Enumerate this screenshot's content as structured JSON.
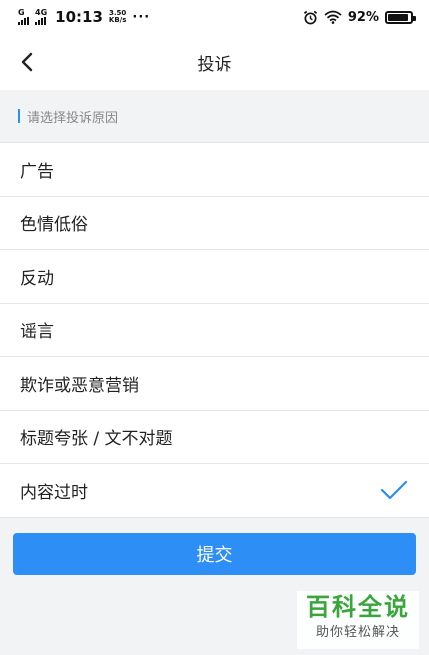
{
  "status_bar": {
    "network_top": "G",
    "network_type": "4G",
    "time": "10:13",
    "speed_value": "3.50",
    "speed_unit": "KB/s",
    "more": "···",
    "alarm_icon": "alarm-clock-icon",
    "wifi_icon": "wifi-icon",
    "battery_percent": "92%",
    "battery_level": 0.92
  },
  "header": {
    "back_icon": "chevron-left-icon",
    "title": "投诉"
  },
  "section": {
    "label": "请选择投诉原因",
    "accent_color": "#2b8ef1"
  },
  "reasons": [
    {
      "label": "广告",
      "selected": false
    },
    {
      "label": "色情低俗",
      "selected": false
    },
    {
      "label": "反动",
      "selected": false
    },
    {
      "label": "谣言",
      "selected": false
    },
    {
      "label": "欺诈或恶意营销",
      "selected": false
    },
    {
      "label": "标题夸张 / 文不对题",
      "selected": false
    },
    {
      "label": "内容过时",
      "selected": true
    }
  ],
  "submit": {
    "label": "提交",
    "color": "#2d8ef5"
  },
  "watermark": {
    "title": "百科全说",
    "subtitle": "助你轻松解决"
  }
}
